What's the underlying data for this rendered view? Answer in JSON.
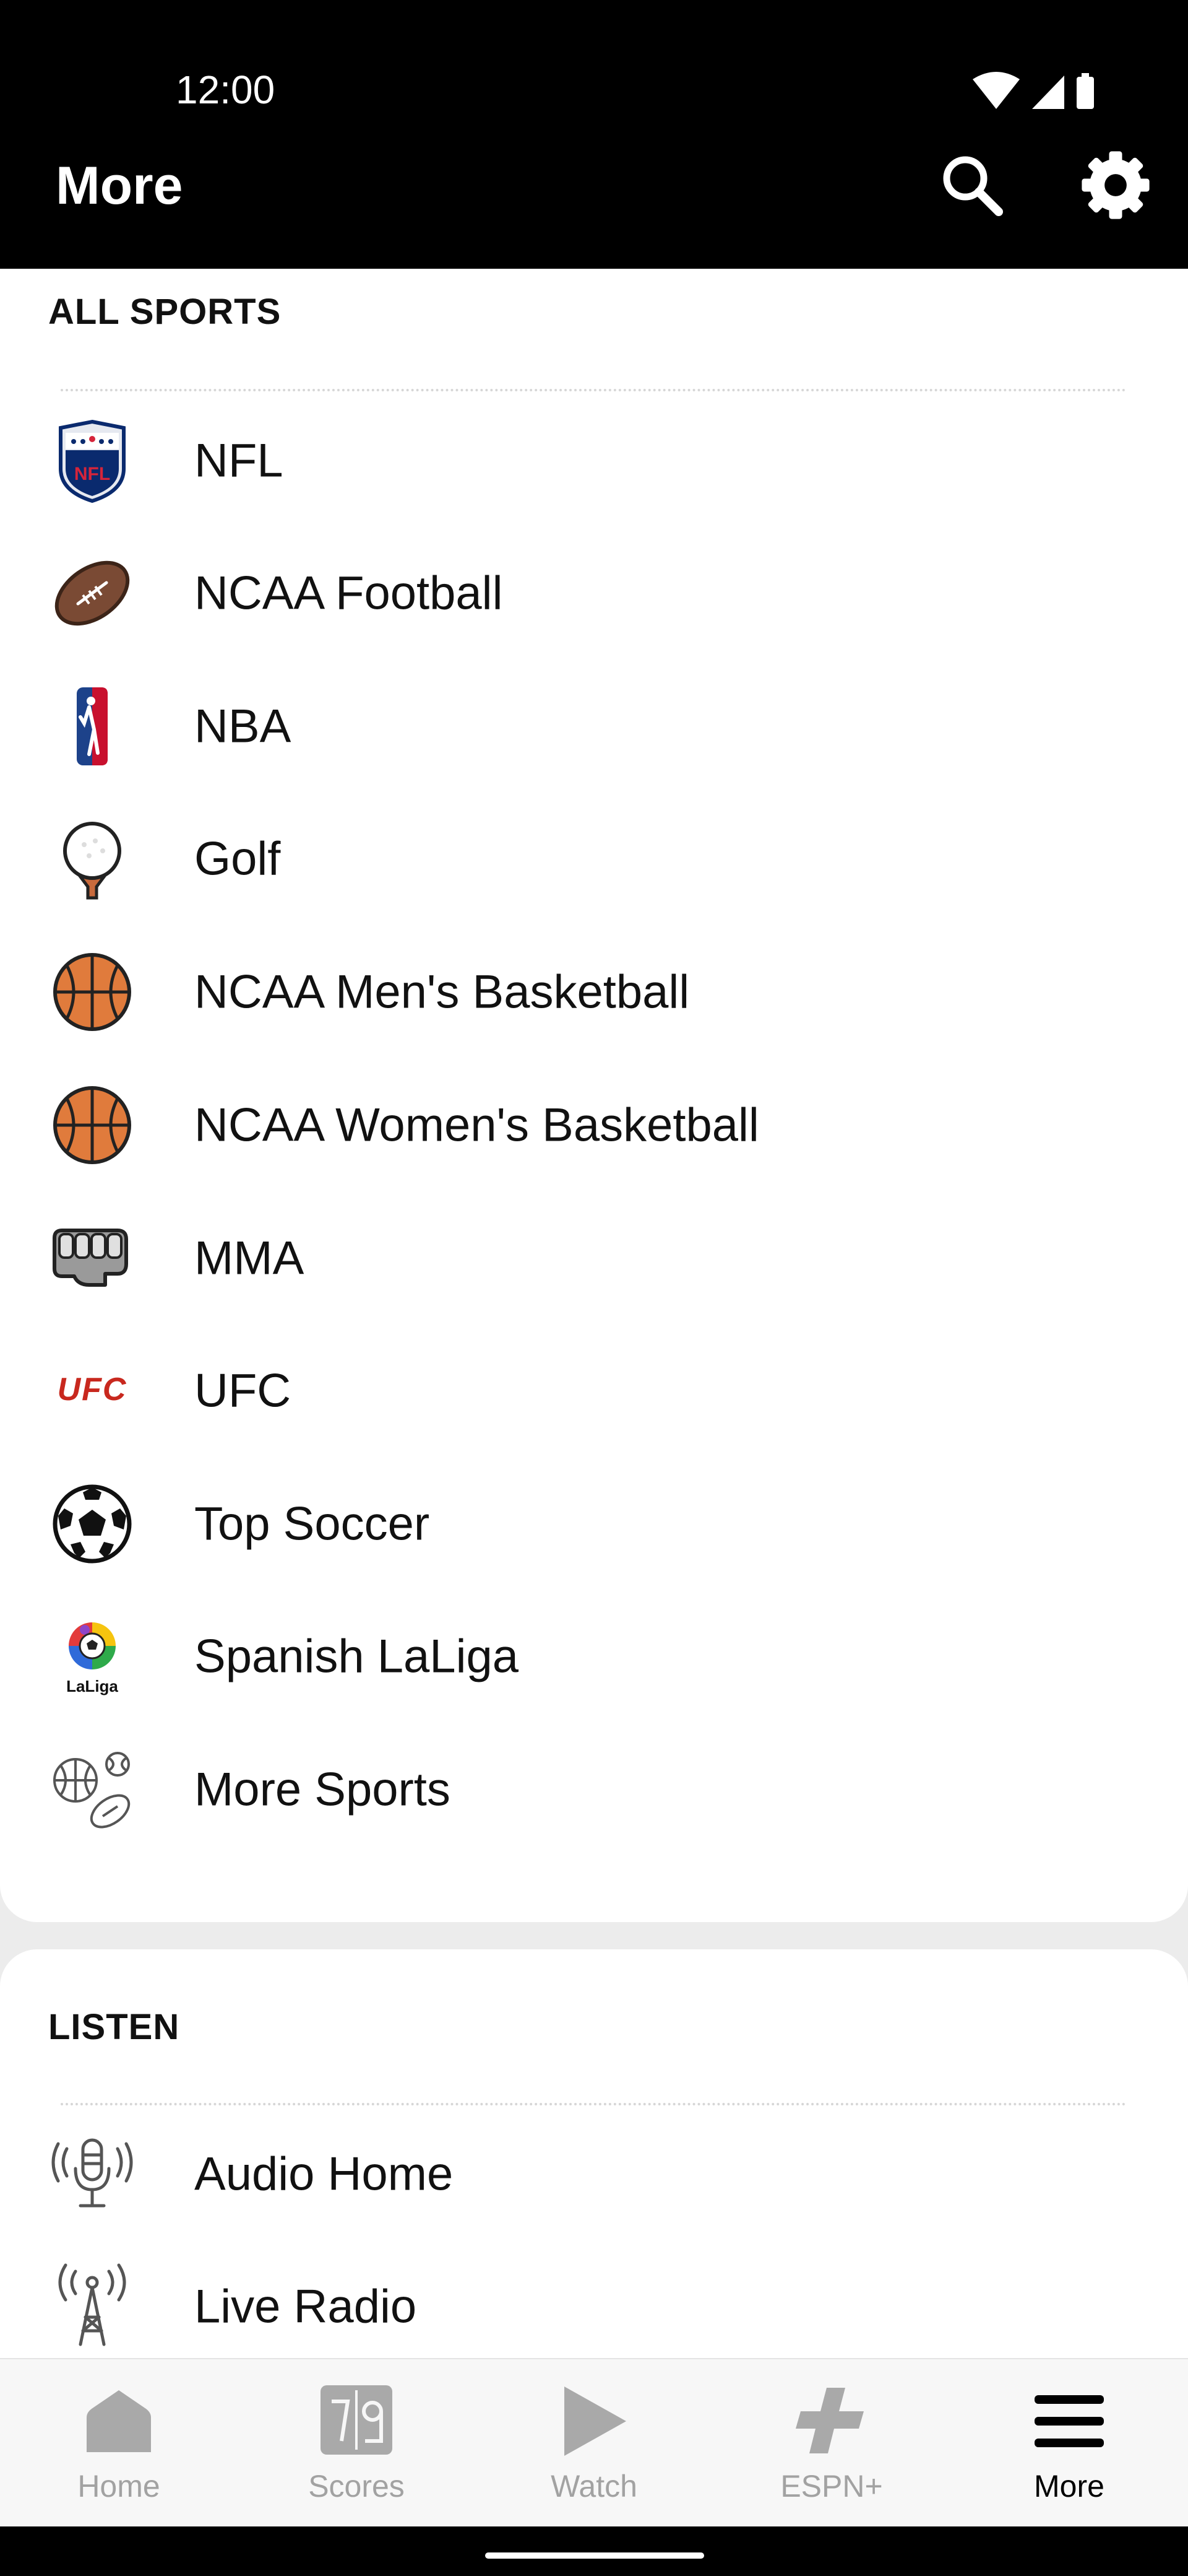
{
  "status_bar": {
    "time": "12:00"
  },
  "header": {
    "title": "More",
    "search_icon": "search-icon",
    "settings_icon": "gear-icon"
  },
  "all_sports": {
    "heading": "ALL SPORTS",
    "items": [
      {
        "label": "NFL",
        "icon": "nfl-logo-icon"
      },
      {
        "label": "NCAA Football",
        "icon": "football-icon"
      },
      {
        "label": "NBA",
        "icon": "nba-logo-icon"
      },
      {
        "label": "Golf",
        "icon": "golf-ball-icon"
      },
      {
        "label": "NCAA Men's Basketball",
        "icon": "basketball-icon"
      },
      {
        "label": "NCAA Women's Basketball",
        "icon": "basketball-icon"
      },
      {
        "label": "MMA",
        "icon": "fist-icon"
      },
      {
        "label": "UFC",
        "icon": "ufc-logo-icon",
        "logo_text": "UFC"
      },
      {
        "label": "Top Soccer",
        "icon": "soccer-ball-icon"
      },
      {
        "label": "Spanish LaLiga",
        "icon": "laliga-logo-icon",
        "logo_text": "LaLiga"
      },
      {
        "label": "More Sports",
        "icon": "more-sports-icon"
      }
    ]
  },
  "listen": {
    "heading": "LISTEN",
    "items": [
      {
        "label": "Audio Home",
        "icon": "microphone-icon"
      },
      {
        "label": "Live Radio",
        "icon": "radio-tower-icon"
      }
    ]
  },
  "bottom_nav": {
    "items": [
      {
        "label": "Home",
        "icon": "home-icon",
        "active": false
      },
      {
        "label": "Scores",
        "icon": "scoreboard-icon",
        "active": false
      },
      {
        "label": "Watch",
        "icon": "play-icon",
        "active": false
      },
      {
        "label": "ESPN+",
        "icon": "espn-plus-icon",
        "active": false
      },
      {
        "label": "More",
        "icon": "hamburger-menu-icon",
        "active": true
      }
    ]
  },
  "colors": {
    "app_bar": "#000000",
    "nav_inactive": "#a2a2a2",
    "nav_active": "#000000",
    "ufc_red": "#c8281e",
    "basketball_orange": "#e07b3c"
  }
}
